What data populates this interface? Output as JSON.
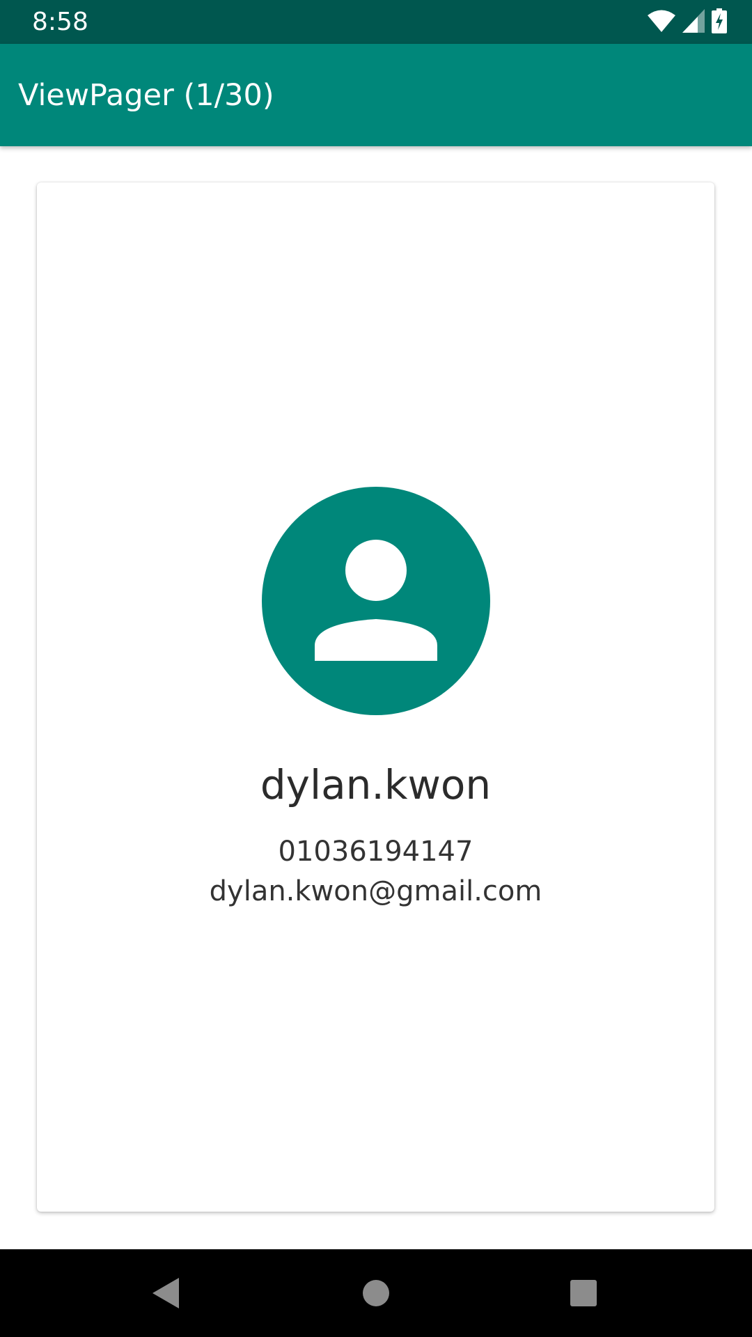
{
  "status_bar": {
    "time": "8:58",
    "icons": [
      "wifi-icon",
      "cell-signal-icon",
      "battery-charging-icon"
    ]
  },
  "app_bar": {
    "title": "ViewPager (1/30)"
  },
  "card": {
    "avatar_icon": "account-circle-icon",
    "name": "dylan.kwon",
    "phone": "01036194147",
    "email": "dylan.kwon@gmail.com"
  },
  "nav_bar": {
    "buttons": [
      "back-icon",
      "home-icon",
      "recents-icon"
    ]
  },
  "colors": {
    "status_bar": "#00574f",
    "primary": "#00877a",
    "text": "#2b2b2b"
  }
}
